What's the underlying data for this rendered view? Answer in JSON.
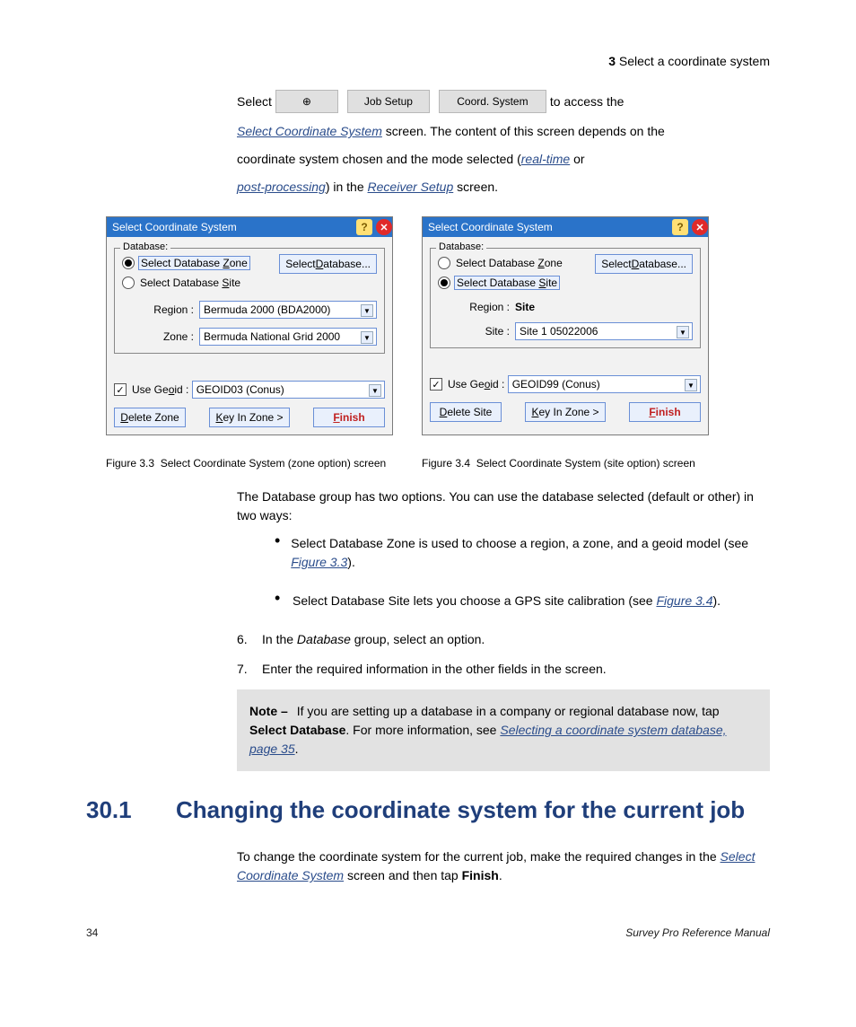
{
  "header": {
    "section_number": "3",
    "section_label": "  Select a coordinate system"
  },
  "line1_before": "Select ",
  "menupath": {
    "icon_label": "⊕",
    "item1": "Job Setup",
    "item2": "Coord. System"
  },
  "line1_after": " to access the",
  "line2_a": "Select Coordinate System",
  "line2_b": " screen. The content of this screen depends on the",
  "line3_a": "coordinate system chosen and the mode selected (",
  "line3_b": "real-time",
  "line3_c": " or",
  "line4_a": "post-processing",
  "line4_b": ") in the ",
  "line4_c": "Receiver Setup",
  "line4_d": " screen.",
  "dialog": {
    "title": "Select Coordinate System",
    "legend": "Database:",
    "radio_zone": "Select Database Zone",
    "radio_zone_u": "Z",
    "radio_site": "Select Database Site",
    "radio_site_u": "S",
    "btn_selectdb": "Select Database...",
    "btn_selectdb_u": "D",
    "lbl_region": "Region :",
    "lbl_zone": "Zone :",
    "lbl_site": "Site :",
    "left_region_val": "Bermuda 2000 (BDA2000)",
    "left_zone_val": "Bermuda National Grid 2000",
    "right_region_val": "Site",
    "right_site_val": "Site 1 05022006",
    "use_geoid": "Use Geoid :",
    "use_geoid_u": "o",
    "geoid_left": "GEOID03 (Conus)",
    "geoid_right": "GEOID99 (Conus)",
    "btn_delete_zone": "Delete Zone",
    "btn_delete_zone_u": "D",
    "btn_delete_site": "Delete Site",
    "btn_delete_site_u": "D",
    "btn_keyin": "Key In Zone >",
    "btn_keyin_u": "K",
    "btn_finish": "Finish",
    "btn_finish_u": "F"
  },
  "fig_label_left_a": "Figure 3.3",
  "fig_label_left_b": "Select Coordinate System (zone option) screen",
  "fig_label_right_a": "Figure 3.4",
  "fig_label_right_b": "Select Coordinate System (site option) screen",
  "bullet_intro": "The Database group has two options. You can use the database selected (default or other) in two ways:",
  "bullet1a": "Select Database Zone is used to choose a region, a zone, and a geoid model (see ",
  "bullet1b": "Figure 3.3",
  "bullet1c": ").",
  "bullet2a": "Select Database Site lets you choose a GPS site calibration (see ",
  "bullet2b": "Figure 3.4",
  "bullet2c": ").",
  "step6": {
    "n": "6.",
    "a": "In the ",
    "b": "Database",
    "c": " group, select an option."
  },
  "step7": {
    "n": "7.",
    "a": "Enter the required information in the other fields in the screen."
  },
  "note": {
    "label": "Note – ",
    "a": "If you are setting up a database in a company or regional database now, tap ",
    "b": "Select Database",
    "c": ". For more information, see ",
    "d": "Selecting a coordinate system database, page 35",
    "e": "."
  },
  "subsection": {
    "num": "30.1",
    "title": "Changing the coordinate system for the current job"
  },
  "sub_para": {
    "a": "To change the coordinate system for the current job, make the required changes in the ",
    "b": "Select Coordinate System",
    "c": " screen and then tap ",
    "d": "Finish",
    "e": "."
  },
  "footer": {
    "left": "34",
    "right": "Survey Pro Reference Manual"
  }
}
